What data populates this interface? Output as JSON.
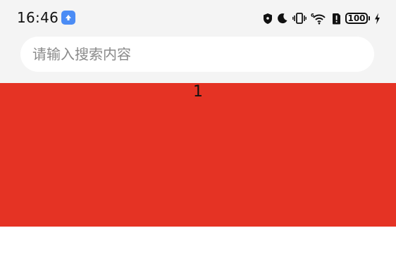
{
  "status_bar": {
    "time": "16:46",
    "battery_level": "100",
    "icons": [
      "app-notification-icon",
      "shield-icon",
      "moon-icon",
      "vibrate-icon",
      "wifi-6-icon",
      "sim-alert-icon",
      "battery-icon",
      "charging-icon"
    ]
  },
  "search": {
    "placeholder": "请输入搜索内容",
    "value": ""
  },
  "content": {
    "block_label": "1",
    "block_color": "#e53324"
  }
}
